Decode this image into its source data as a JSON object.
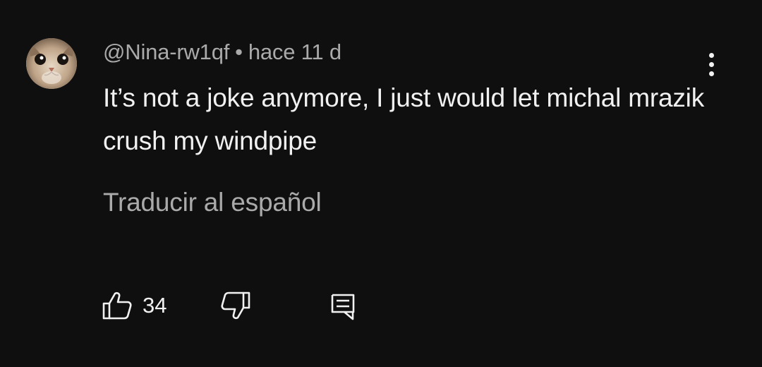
{
  "comment": {
    "author": "@Nina-rw1qf",
    "separator": "•",
    "time": "hace 11 d",
    "text": "It’s not a joke anymore, I just would let michal mrazik crush my windpipe",
    "translate_label": "Traducir al español",
    "like_count": "34"
  },
  "icons": {
    "avatar": "cat-avatar",
    "more": "more-vertical-icon",
    "like": "thumbs-up-icon",
    "dislike": "thumbs-down-icon",
    "reply": "reply-comment-icon"
  },
  "colors": {
    "background": "#0f0f0f",
    "primary_text": "#f1f1f1",
    "secondary_text": "#aaaaaa"
  }
}
